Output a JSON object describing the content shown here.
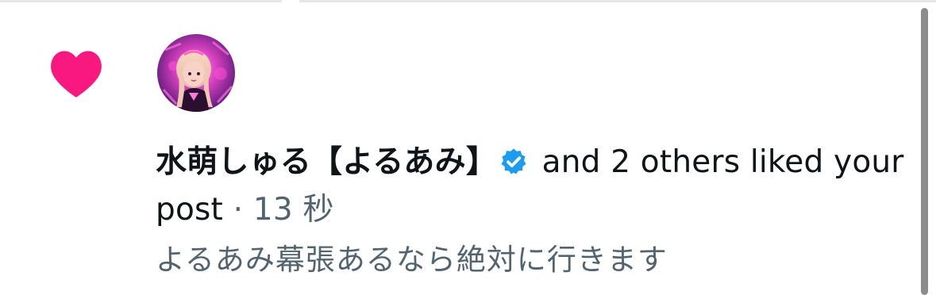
{
  "notification": {
    "type": "like",
    "icon": "heart-icon",
    "icon_color": "#f91880",
    "avatar_icon": "user-avatar",
    "actor_name": "水萌しゅる【よるあみ】",
    "verified_icon": "verified-badge-icon",
    "verified_color": "#1d9bf0",
    "action_text": " and 2 others liked your post",
    "separator": " · ",
    "timestamp": "13 秒",
    "post_text": "よるあみ幕張あるなら絶対に行きます"
  },
  "colors": {
    "text_primary": "#0f1419",
    "text_secondary": "#536471",
    "background": "#ffffff"
  }
}
